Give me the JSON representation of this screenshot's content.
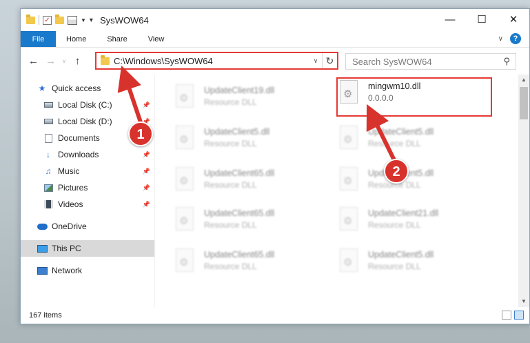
{
  "window": {
    "title": "SysWOW64"
  },
  "ribbon": {
    "tabs": [
      "File",
      "Home",
      "Share",
      "View"
    ]
  },
  "address": {
    "path": "C:\\Windows\\SysWOW64"
  },
  "search": {
    "placeholder": "Search SysWOW64"
  },
  "nav": {
    "quick_access": "Quick access",
    "items": [
      {
        "label": "Local Disk (C:)",
        "icon": "drive-icon",
        "pinned": true
      },
      {
        "label": "Local Disk (D:)",
        "icon": "drive-icon",
        "pinned": true
      },
      {
        "label": "Documents",
        "icon": "documents-icon",
        "pinned": true
      },
      {
        "label": "Downloads",
        "icon": "downloads-icon",
        "pinned": true
      },
      {
        "label": "Music",
        "icon": "music-icon",
        "pinned": true
      },
      {
        "label": "Pictures",
        "icon": "pictures-icon",
        "pinned": true
      },
      {
        "label": "Videos",
        "icon": "videos-icon",
        "pinned": true
      }
    ],
    "onedrive": "OneDrive",
    "this_pc": "This PC",
    "network": "Network"
  },
  "files": [
    {
      "name": "UpdateClient19.dll",
      "type": "Resource DLL"
    },
    {
      "name": "mingwm10.dll",
      "type": "0.0.0.0"
    },
    {
      "name": "UpdateClient5.dll",
      "type": "Resource DLL"
    },
    {
      "name": "UpdateClient5.dll",
      "type": "Resource DLL"
    },
    {
      "name": "UpdateClient65.dll",
      "type": "Resource DLL"
    },
    {
      "name": "UpdateClient5.dll",
      "type": "Resource DLL"
    },
    {
      "name": "UpdateClient65.dll",
      "type": "Resource DLL"
    },
    {
      "name": "UpdateClient21.dll",
      "type": "Resource DLL"
    },
    {
      "name": "UpdateClient65.dll",
      "type": "Resource DLL"
    },
    {
      "name": "UpdateClient5.dll",
      "type": "Resource DLL"
    }
  ],
  "status": {
    "item_count": "167 items"
  },
  "callouts": {
    "one": "1",
    "two": "2"
  },
  "colors": {
    "highlight": "#e53935",
    "callout": "#d8322d",
    "file_tab": "#1979ca"
  }
}
